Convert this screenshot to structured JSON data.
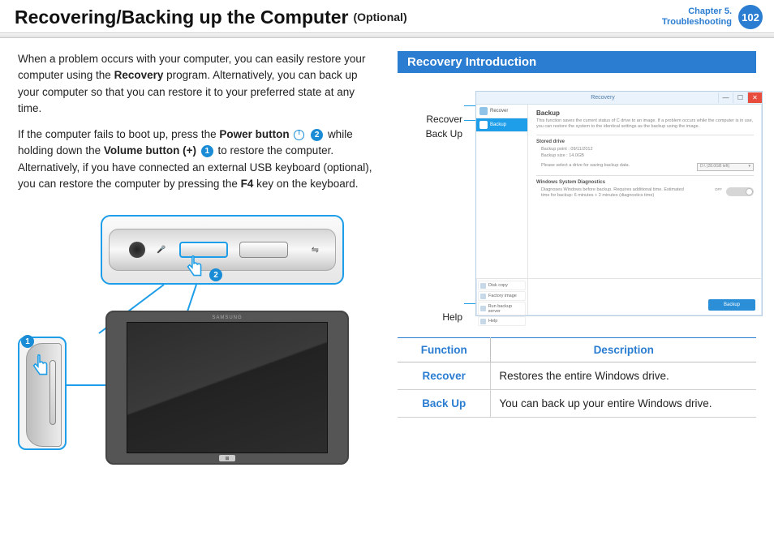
{
  "header": {
    "title": "Recovering/Backing up the Computer",
    "optional": "(Optional)",
    "chapter_line1": "Chapter 5.",
    "chapter_line2": "Troubleshooting",
    "page": "102"
  },
  "left": {
    "p1_a": "When a problem occurs with your computer, you can easily restore your computer using the ",
    "p1_b": "Recovery",
    "p1_c": " program. Alternatively, you can back up your computer so that you can restore it to your preferred state at any time.",
    "p2_a": "If the computer fails to boot up, press the ",
    "p2_b": "Power button",
    "p2_c": " while holding down the ",
    "p2_d": "Volume button (+)",
    "p2_e": " to restore the computer. Alternatively, if you have connected an external USB keyboard (optional), you can restore the computer by pressing the ",
    "p2_f": "F4",
    "p2_g": " key on the keyboard.",
    "badge1": "1",
    "badge2": "2",
    "tablet_brand": "SAMSUNG",
    "win_home": "⊞"
  },
  "right": {
    "section": "Recovery Introduction",
    "labels": {
      "recover": "Recover",
      "backup": "Back Up",
      "help": "Help"
    },
    "app": {
      "title": "Recovery",
      "min": "—",
      "max": "☐",
      "close": "✕",
      "sb_recover": "Recover",
      "sb_backup": "Backup",
      "mp_title": "Backup",
      "mp_sub": "This function saves the current status of C drive to an image.\nIf a problem occurs while the computer is in use, you can restore the system to the identical settings as the backup using the image.",
      "grp1_title": "Stored drive",
      "grp1_l1": "Backup point : 09/11/2012",
      "grp1_l2": "Backup size : 14.0GB",
      "grp1_l3": "Please select a drive for saving backup data.",
      "grp1_dd": "D:\\ (28.0GB left)",
      "grp2_title": "Windows System Diagnostics",
      "grp2_body": "Diagnoses Windows before backup. Requires additional time.\nEstimated time for backup: 6 minutes + 2 minutes (diagnostics time)",
      "bb1": "Disk copy",
      "bb2": "Factory image",
      "bb3": "Run backup server",
      "bb4": "Help",
      "action": "Backup"
    },
    "table": {
      "h1": "Function",
      "h2": "Description",
      "r1f": "Recover",
      "r1d": "Restores the entire Windows drive.",
      "r2f": "Back Up",
      "r2d": "You can back up your entire Windows drive."
    }
  }
}
